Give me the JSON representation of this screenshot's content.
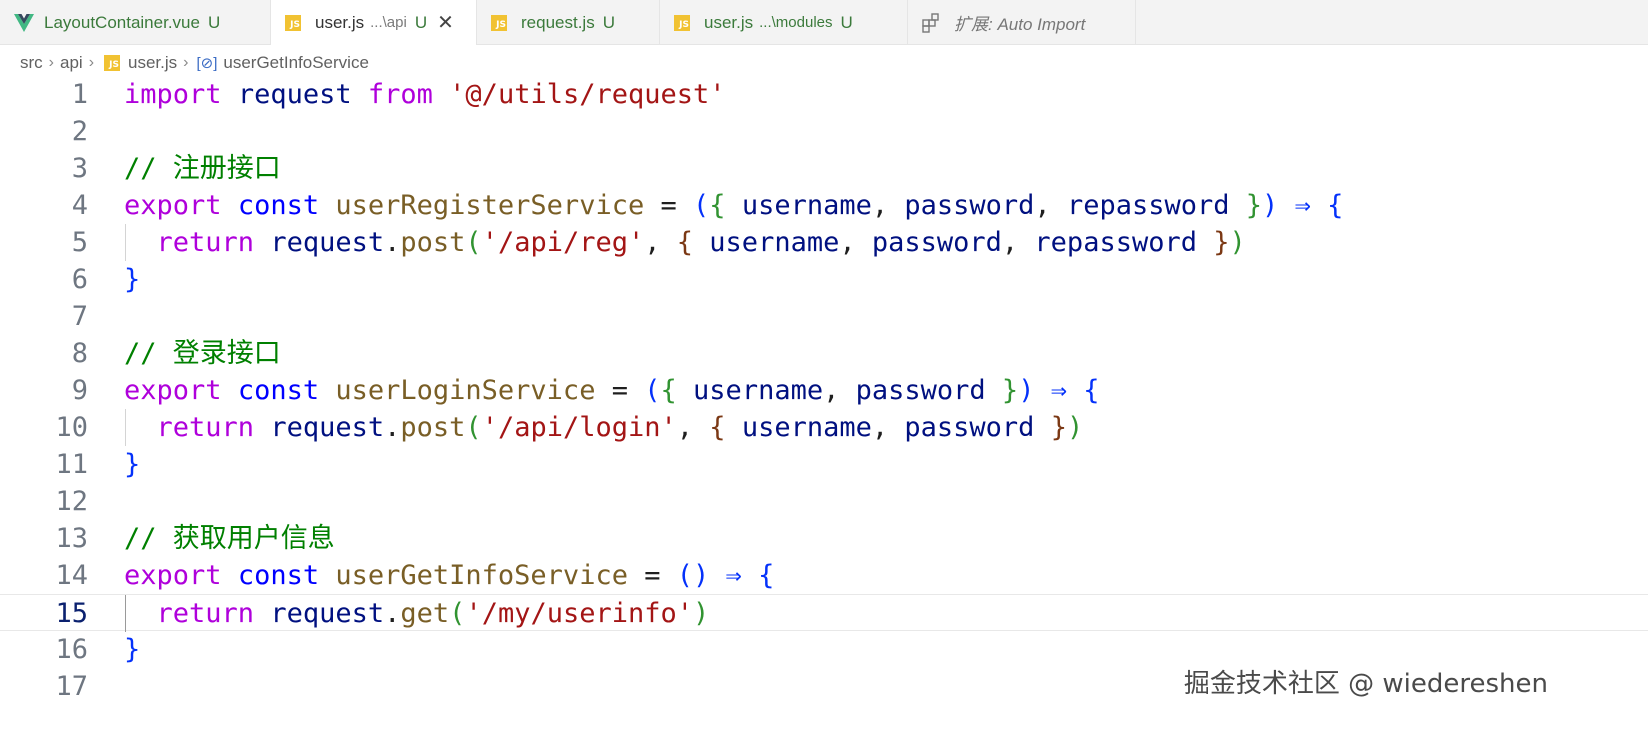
{
  "tabs": [
    {
      "icon": "vue-icon",
      "label": "LayoutContainer.vue",
      "hint": "",
      "status": "U",
      "active": false
    },
    {
      "icon": "js-icon",
      "label": "user.js",
      "hint": "...\\api",
      "status": "U",
      "active": true
    },
    {
      "icon": "js-icon",
      "label": "request.js",
      "hint": "",
      "status": "U",
      "active": false
    },
    {
      "icon": "js-icon",
      "label": "user.js",
      "hint": "...\\modules",
      "status": "U",
      "active": false
    },
    {
      "icon": "extension-icon",
      "label": "扩展: Auto Import",
      "hint": "",
      "status": "",
      "active": false
    }
  ],
  "breadcrumb": {
    "items": [
      "src",
      "api",
      "user.js",
      "userGetInfoService"
    ]
  },
  "editor": {
    "current_line": 15,
    "lines": [
      {
        "n": "1",
        "text": "import request from '@/utils/request'"
      },
      {
        "n": "2",
        "text": ""
      },
      {
        "n": "3",
        "text": "// 注册接口"
      },
      {
        "n": "4",
        "text": "export const userRegisterService = ({ username, password, repassword }) ⇒ {"
      },
      {
        "n": "5",
        "text": "  return request.post('/api/reg', { username, password, repassword })"
      },
      {
        "n": "6",
        "text": "}"
      },
      {
        "n": "7",
        "text": ""
      },
      {
        "n": "8",
        "text": "// 登录接口"
      },
      {
        "n": "9",
        "text": "export const userLoginService = ({ username, password }) ⇒ {"
      },
      {
        "n": "10",
        "text": "  return request.post('/api/login', { username, password })"
      },
      {
        "n": "11",
        "text": "}"
      },
      {
        "n": "12",
        "text": ""
      },
      {
        "n": "13",
        "text": "// 获取用户信息"
      },
      {
        "n": "14",
        "text": "export const userGetInfoService = () ⇒ {"
      },
      {
        "n": "15",
        "text": "  return request.get('/my/userinfo')"
      },
      {
        "n": "16",
        "text": "}"
      },
      {
        "n": "17",
        "text": ""
      }
    ]
  },
  "watermark": "掘金技术社区 @ wiedereshen",
  "colors": {
    "keyword": "#af00db",
    "storage": "#0000ff",
    "string": "#a31515",
    "variable": "#001080",
    "function": "#795e26",
    "comment": "#008000"
  }
}
